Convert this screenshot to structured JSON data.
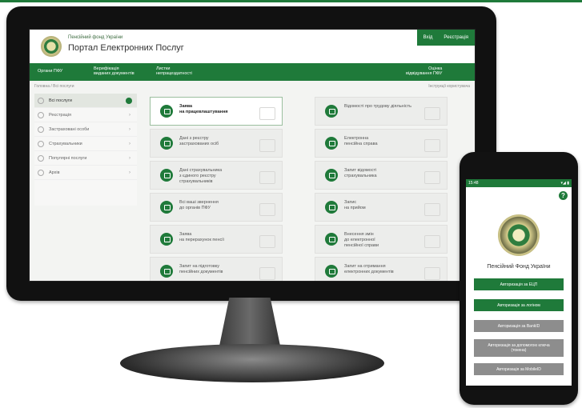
{
  "site": {
    "fund_name": "Пенсійний фонд України",
    "portal_title": "Портал Електронних Послуг",
    "login": "Вхід",
    "register": "Реєстрація"
  },
  "nav": {
    "items": [
      {
        "label": "Органи ПФУ"
      },
      {
        "label": "Верифікація\nвиданих документів"
      },
      {
        "label": "Листки\nнепрацездатності"
      },
      {
        "label": "Оцінка\nвідвідування ПФУ"
      }
    ]
  },
  "breadcrumb": "Головна / Всі послуги",
  "breadcrumb_right": "Інструкції користувача",
  "sidebar": {
    "items": [
      {
        "label": "Всі послуги",
        "active": true
      },
      {
        "label": "Реєстрація"
      },
      {
        "label": "Застраховані особи"
      },
      {
        "label": "Страхувальники"
      },
      {
        "label": "Популярні послуги"
      },
      {
        "label": "Архів"
      }
    ]
  },
  "services": [
    {
      "label": "Заява\nна працевлаштування",
      "active": true
    },
    {
      "label": "Відомості про трудову діяльність"
    },
    {
      "label": "Дані з реєстру\nзастрахованих осіб"
    },
    {
      "label": "Електронна\nпенсійна справа"
    },
    {
      "label": "Дані страхувальника\nз єдиного реєстру\nстрахувальників"
    },
    {
      "label": "Запит відомості\nстрахувальника"
    },
    {
      "label": "Всі ваші звернення\nдо органів ПФУ"
    },
    {
      "label": "Запис\nна прийом"
    },
    {
      "label": "Заява\nна перерахунок пенсії"
    },
    {
      "label": "Внесення змін\nдо електронної\nпенсійної справи"
    },
    {
      "label": "Запит на підготовку\nпенсійних документів"
    },
    {
      "label": "Запит на отримання\nелектронних документів"
    }
  ],
  "phone": {
    "time": "15:48",
    "signal": "▾◢ ▮",
    "help": "?",
    "fund_name": "Пенсійний Фонд України",
    "buttons": [
      {
        "label": "Авторизація за ЕЦП",
        "style": "green"
      },
      {
        "label": "Авторизація за логіном",
        "style": "green"
      },
      {
        "label": "Авторизація за BankID",
        "style": "grey"
      },
      {
        "label": "Авторизація за допомогою ключа\n(токена)",
        "style": "grey"
      },
      {
        "label": "Авторизація за MobileID",
        "style": "grey"
      }
    ]
  },
  "colors": {
    "accent": "#1f7a3a",
    "button_grey": "#8d8d8d"
  }
}
